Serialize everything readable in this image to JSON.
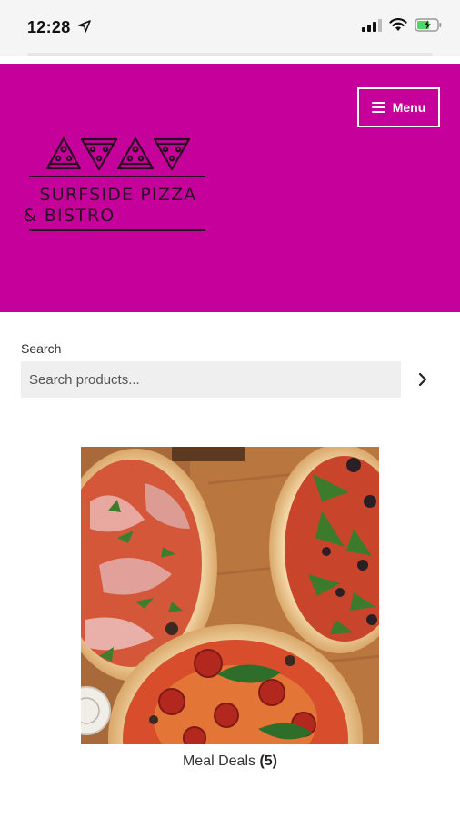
{
  "status_bar": {
    "time": "12:28",
    "icons": [
      "location-arrow-icon",
      "signal-icon",
      "wifi-icon",
      "battery-charging-icon"
    ]
  },
  "header": {
    "background_color": "#c6009a",
    "menu_label": "Menu",
    "logo_line1": "SURFSIDE PIZZA",
    "logo_line2": "& BISTRO"
  },
  "search": {
    "label": "Search",
    "placeholder": "Search products...",
    "submit_icon": "chevron-right-icon"
  },
  "categories": [
    {
      "name": "Meal Deals",
      "count": "(5)"
    }
  ]
}
